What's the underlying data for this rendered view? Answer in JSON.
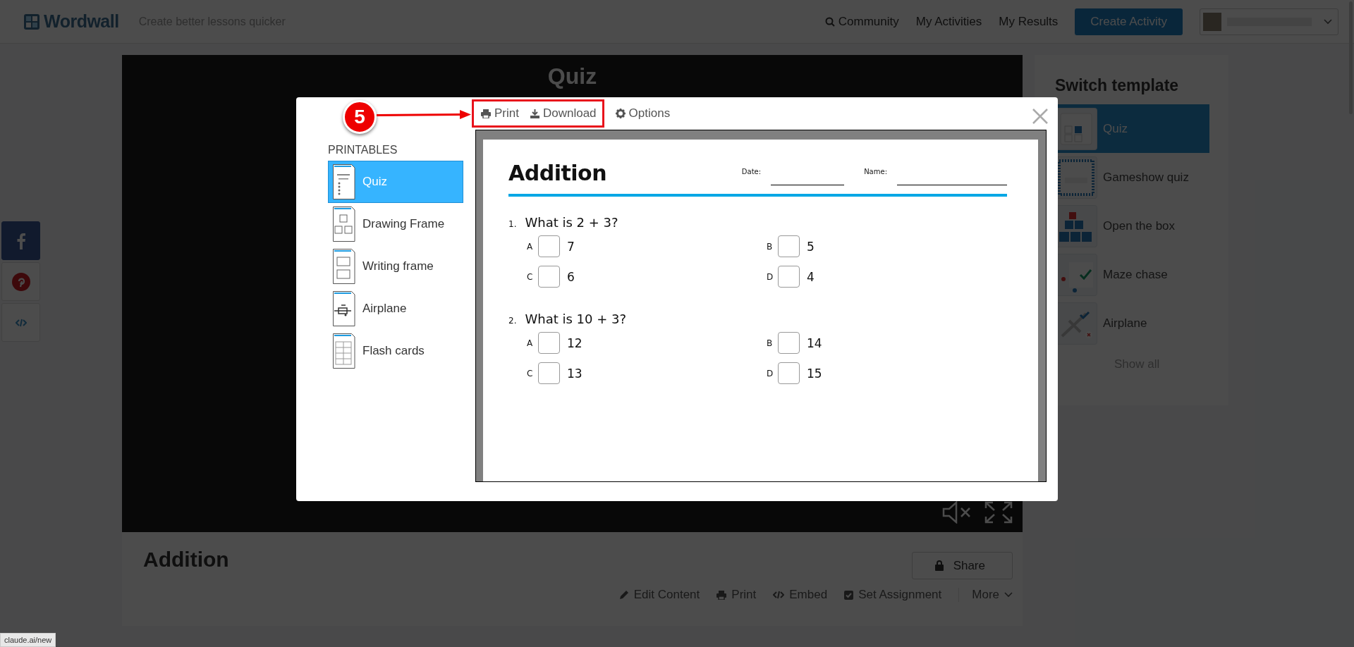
{
  "header": {
    "logo_text": "Wordwall",
    "tagline": "Create better lessons quicker",
    "nav": [
      {
        "label": "Community",
        "kind": "search"
      },
      {
        "label": "My Activities",
        "kind": "plain"
      },
      {
        "label": "My Results",
        "kind": "plain"
      }
    ],
    "create_button": "Create Activity"
  },
  "game": {
    "title": "Quiz"
  },
  "activity": {
    "title": "Addition",
    "share_button": "Share",
    "actions": [
      {
        "label": "Edit Content",
        "kind": "edit"
      },
      {
        "label": "Print",
        "kind": "print"
      },
      {
        "label": "Embed",
        "kind": "embed"
      },
      {
        "label": "Set Assignment",
        "kind": "assign"
      }
    ],
    "more": "More"
  },
  "sidebar": {
    "heading": "Switch template",
    "templates": [
      {
        "label": "Quiz",
        "kind": "quiz",
        "selected": true
      },
      {
        "label": "Gameshow quiz",
        "kind": "gameshow",
        "selected": false
      },
      {
        "label": "Open the box",
        "kind": "openbox",
        "selected": false
      },
      {
        "label": "Maze chase",
        "kind": "maze",
        "selected": false
      },
      {
        "label": "Airplane",
        "kind": "airplane",
        "selected": false
      }
    ],
    "show_all": "Show all"
  },
  "modal": {
    "callout": "5",
    "toolbar": [
      {
        "label": "Print",
        "kind": "print",
        "highlighted": true
      },
      {
        "label": "Download",
        "kind": "download",
        "highlighted": true
      },
      {
        "label": "Options",
        "kind": "options",
        "highlighted": false
      }
    ],
    "printables_heading": "PRINTABLES",
    "printables": [
      {
        "label": "Quiz",
        "kind": "quiz",
        "selected": true
      },
      {
        "label": "Drawing Frame",
        "kind": "drawing",
        "selected": false
      },
      {
        "label": "Writing frame",
        "kind": "writing",
        "selected": false
      },
      {
        "label": "Airplane",
        "kind": "airplane",
        "selected": false
      },
      {
        "label": "Flash cards",
        "kind": "flash",
        "selected": false
      }
    ],
    "worksheet": {
      "title": "Addition",
      "date_label": "Date:",
      "name_label": "Name:",
      "questions": [
        {
          "number": "1.",
          "text": "What is 2 + 3?",
          "options": [
            {
              "letter": "A",
              "answer": "7"
            },
            {
              "letter": "B",
              "answer": "5"
            },
            {
              "letter": "C",
              "answer": "6"
            },
            {
              "letter": "D",
              "answer": "4"
            }
          ]
        },
        {
          "number": "2.",
          "text": "What is 10 + 3?",
          "options": [
            {
              "letter": "A",
              "answer": "12"
            },
            {
              "letter": "B",
              "answer": "14"
            },
            {
              "letter": "C",
              "answer": "13"
            },
            {
              "letter": "D",
              "answer": "15"
            }
          ]
        }
      ]
    }
  },
  "status_bar": "claude.ai/new"
}
